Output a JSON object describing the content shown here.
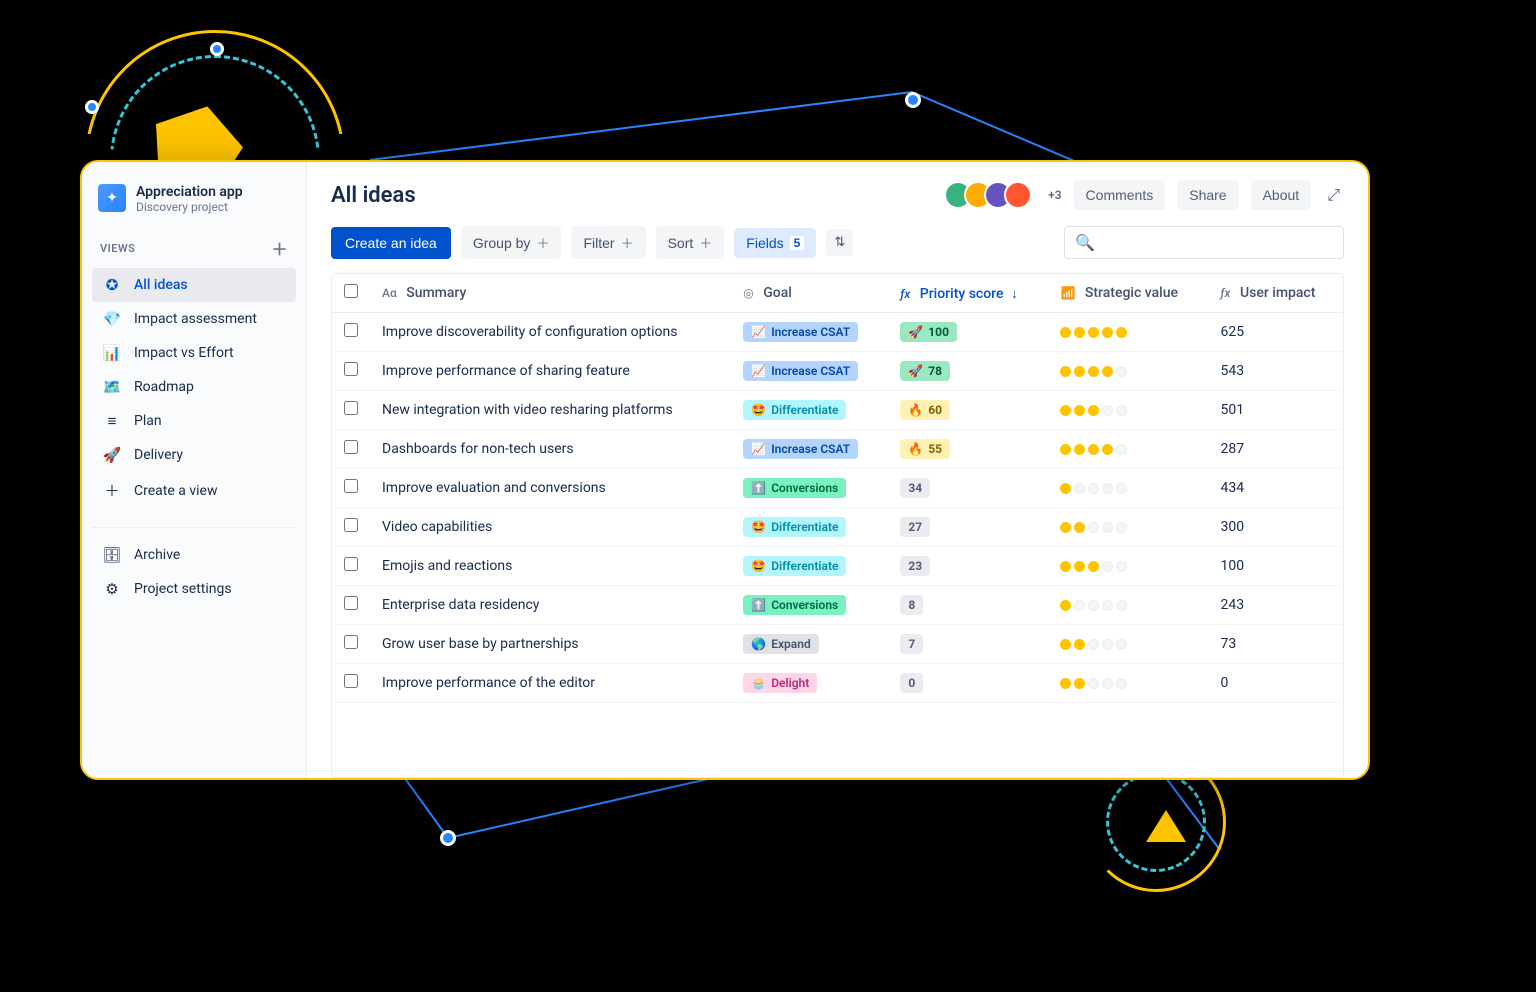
{
  "project": {
    "title": "Appreciation app",
    "subtitle": "Discovery project"
  },
  "sidebar": {
    "views_label": "VIEWS",
    "items": [
      {
        "label": "All ideas",
        "icon": "✪",
        "active": true
      },
      {
        "label": "Impact assessment",
        "icon": "💎",
        "active": false
      },
      {
        "label": "Impact vs Effort",
        "icon": "📊",
        "active": false
      },
      {
        "label": "Roadmap",
        "icon": "🗺️",
        "active": false
      },
      {
        "label": "Plan",
        "icon": "≡",
        "active": false
      },
      {
        "label": "Delivery",
        "icon": "🚀",
        "active": false
      },
      {
        "label": "Create a view",
        "icon": "＋",
        "active": false
      }
    ],
    "archive_label": "Archive",
    "settings_label": "Project settings"
  },
  "header": {
    "title": "All ideas",
    "avatar_more": "+3",
    "buttons": {
      "comments": "Comments",
      "share": "Share",
      "about": "About"
    }
  },
  "toolbar": {
    "create": "Create an idea",
    "groupby": "Group by",
    "filter": "Filter",
    "sort": "Sort",
    "fields": "Fields",
    "fields_count": "5"
  },
  "columns": {
    "summary": "Summary",
    "goal": "Goal",
    "priority": "Priority score",
    "strategic": "Strategic value",
    "impact": "User impact"
  },
  "goal_styles": {
    "Increase CSAT": {
      "cls": "goal-csat",
      "emoji": "📈"
    },
    "Differentiate": {
      "cls": "goal-diff",
      "emoji": "🤩"
    },
    "Conversions": {
      "cls": "goal-conv",
      "emoji": "⬆️"
    },
    "Expand": {
      "cls": "goal-expand",
      "emoji": "🌎"
    },
    "Delight": {
      "cls": "goal-delight",
      "emoji": "🧁"
    }
  },
  "rows": [
    {
      "summary": "Improve discoverability of configuration options",
      "goal": "Increase CSAT",
      "priority": 100,
      "p_tier": "high",
      "stars": 5,
      "impact": 625
    },
    {
      "summary": "Improve performance of sharing feature",
      "goal": "Increase CSAT",
      "priority": 78,
      "p_tier": "high",
      "stars": 4,
      "impact": 543
    },
    {
      "summary": "New integration with video resharing platforms",
      "goal": "Differentiate",
      "priority": 60,
      "p_tier": "med",
      "stars": 3,
      "impact": 501
    },
    {
      "summary": "Dashboards for non-tech users",
      "goal": "Increase CSAT",
      "priority": 55,
      "p_tier": "med",
      "stars": 4,
      "impact": 287
    },
    {
      "summary": "Improve evaluation and conversions",
      "goal": "Conversions",
      "priority": 34,
      "p_tier": "low",
      "stars": 1,
      "impact": 434
    },
    {
      "summary": "Video capabilities",
      "goal": "Differentiate",
      "priority": 27,
      "p_tier": "low",
      "stars": 2,
      "impact": 300
    },
    {
      "summary": "Emojis and reactions",
      "goal": "Differentiate",
      "priority": 23,
      "p_tier": "low",
      "stars": 3,
      "impact": 100
    },
    {
      "summary": "Enterprise data residency",
      "goal": "Conversions",
      "priority": 8,
      "p_tier": "low",
      "stars": 1,
      "impact": 243
    },
    {
      "summary": "Grow user base by partnerships",
      "goal": "Expand",
      "priority": 7,
      "p_tier": "low",
      "stars": 2,
      "impact": 73
    },
    {
      "summary": "Improve performance of the editor",
      "goal": "Delight",
      "priority": 0,
      "p_tier": "low",
      "stars": 2,
      "impact": 0
    }
  ],
  "avatar_colors": [
    "#36b37e",
    "#ffab00",
    "#6554c0",
    "#ff5630"
  ]
}
